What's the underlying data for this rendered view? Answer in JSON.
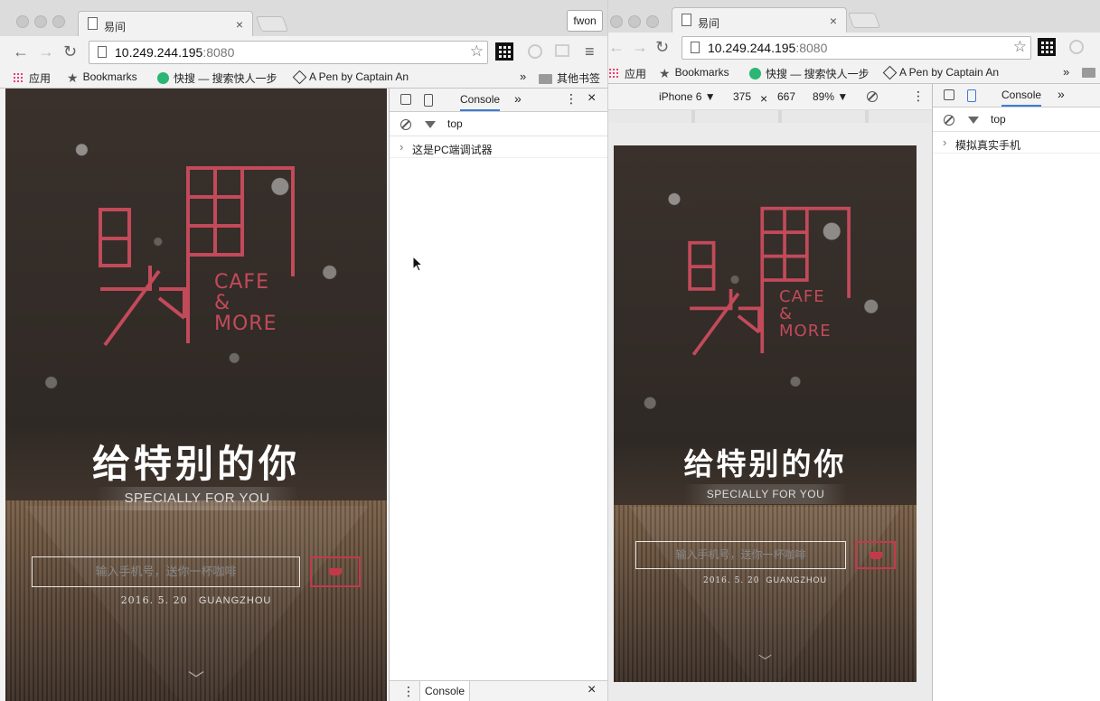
{
  "left_window": {
    "tab_title": "易间",
    "tab_close": "×",
    "profile": "fwon",
    "url_host": "10.249.244.195",
    "url_port": ":8080",
    "bookmarks": [
      {
        "label": "应用",
        "icon": "apps-grid-icon"
      },
      {
        "label": "Bookmarks",
        "icon": "star-icon"
      },
      {
        "label": "快搜 — 搜索快人一步",
        "icon": "green-circle-icon"
      },
      {
        "label": "A Pen by Captain An",
        "icon": "codepen-icon"
      }
    ],
    "bookmarks_overflow": "»",
    "other_bookmarks": "其他书签",
    "app": {
      "cafe": "CAFE",
      "amp": "&",
      "more": "MORE",
      "slogan": "给特别的你",
      "sub": "SPECIALLY FOR YOU",
      "placeholder": "输入手机号，送你一杯咖啡",
      "date": "2016. 5. 20",
      "city": "GUANGZHOU",
      "chevron": "﹀"
    },
    "devtools": {
      "tab_console": "Console",
      "more": "»",
      "close": "×",
      "kebab": "⋮",
      "context": "top",
      "log_message": "这是PC端调试器",
      "expand": "›",
      "drawer_tab": "Console"
    }
  },
  "right_window": {
    "tab_title": "易间",
    "tab_close": "×",
    "url_host": "10.249.244.195",
    "url_port": ":8080",
    "bookmarks": [
      {
        "label": "应用",
        "icon": "apps-grid-icon"
      },
      {
        "label": "Bookmarks",
        "icon": "star-icon"
      },
      {
        "label": "快搜 — 搜索快人一步",
        "icon": "green-circle-icon"
      },
      {
        "label": "A Pen by Captain An",
        "icon": "codepen-icon"
      }
    ],
    "bookmarks_overflow": "»",
    "device": {
      "name": "iPhone 6",
      "width": "375",
      "times": "×",
      "height": "667",
      "zoom": "89%",
      "caret": "▼",
      "kebab": "⋮"
    },
    "app": {
      "cafe": "CAFE",
      "amp": "&",
      "more": "MORE",
      "slogan": "给特别的你",
      "sub": "SPECIALLY FOR YOU",
      "placeholder": "输入手机号，送你一杯咖啡",
      "date": "2016. 5. 20",
      "city": "GUANGZHOU",
      "chevron": "﹀"
    },
    "devtools": {
      "tab_console": "Console",
      "more": "»",
      "context": "top",
      "log_message": "模拟真实手机",
      "expand": "›"
    }
  },
  "colors": {
    "brand_red": "#c23a4a",
    "devtools_accent": "#3e7bd6"
  }
}
